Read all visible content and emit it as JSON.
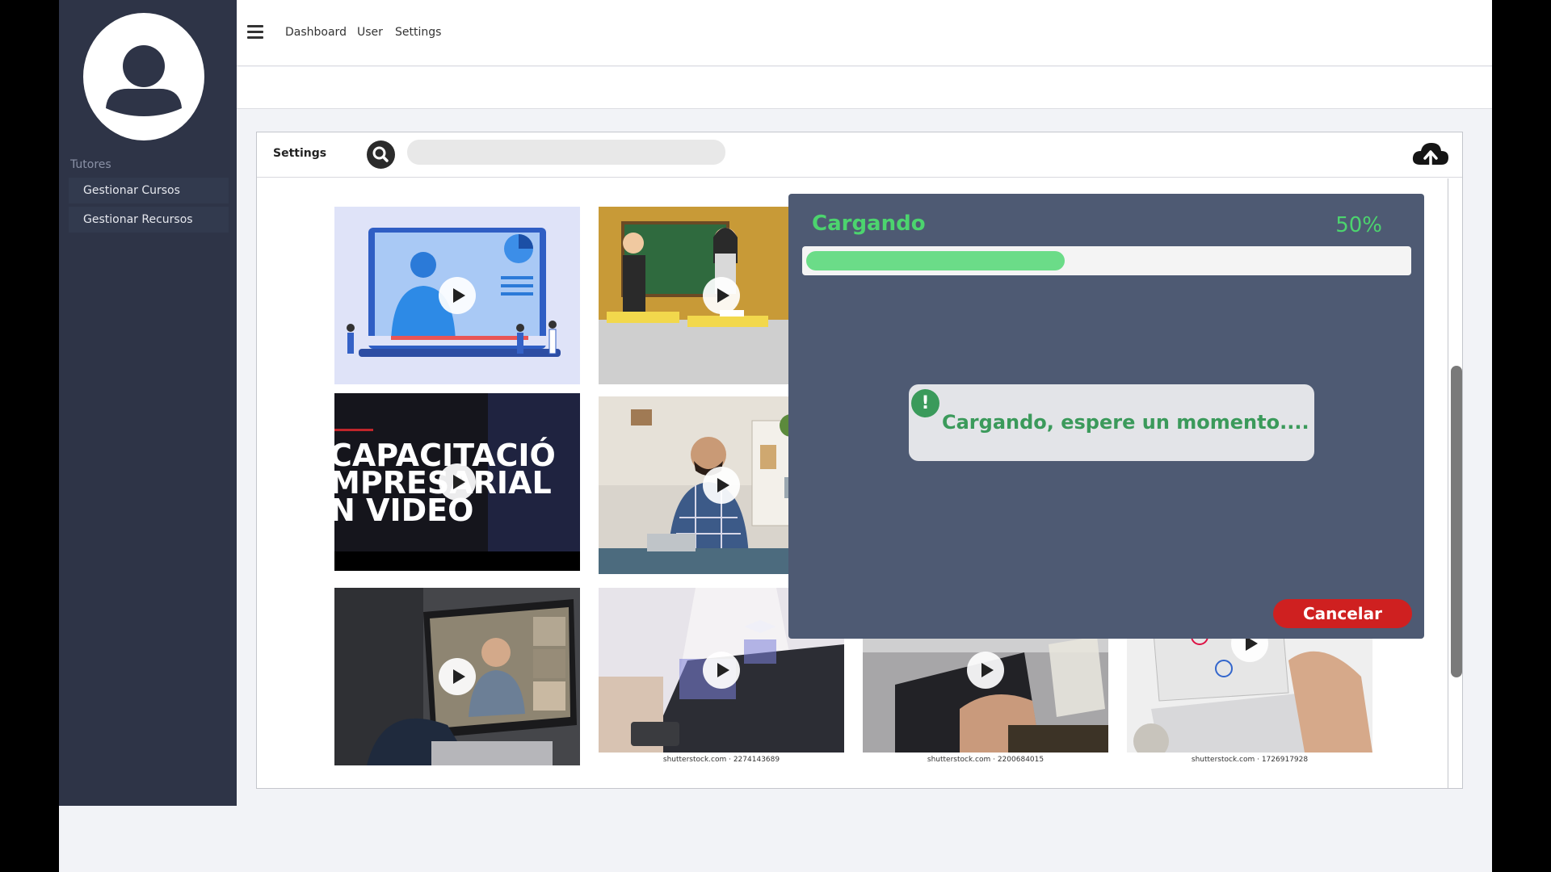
{
  "sidebar": {
    "section_label": "Tutores",
    "items": [
      {
        "label": "Gestionar Cursos"
      },
      {
        "label": "Gestionar Recursos"
      }
    ]
  },
  "header": {
    "nav": [
      "Dashboard",
      "User",
      "Settings"
    ]
  },
  "panel": {
    "title": "Settings",
    "search": {
      "placeholder": "",
      "value": ""
    },
    "tiles": [
      {
        "kind": "illustration-classroom-screen"
      },
      {
        "kind": "illustration-teachers"
      },
      {
        "kind": "title-card",
        "lines": [
          "CAPACITACIÓ",
          "MPRESARIAL",
          "N VIDEO"
        ]
      },
      {
        "kind": "photo-man-talking"
      },
      {
        "kind": "photo-video-call"
      },
      {
        "kind": "photo-laptop-icons",
        "credit": "shutterstock.com · 2274143689"
      },
      {
        "kind": "photo-laptop-book",
        "credit": "shutterstock.com · 2200684015"
      },
      {
        "kind": "photo-laptop-mindmap",
        "credit": "shutterstock.com · 1726917928"
      }
    ]
  },
  "upload_modal": {
    "title": "Cargando",
    "progress": 0.5,
    "progress_label": "50%",
    "message": "Cargando, espere un momento....",
    "cancel_label": "Cancelar"
  },
  "colors": {
    "sidebar": "#2e3447",
    "modal": "#4e5a73",
    "accent_green": "#4cd46e",
    "cancel_red": "#cf2020"
  }
}
